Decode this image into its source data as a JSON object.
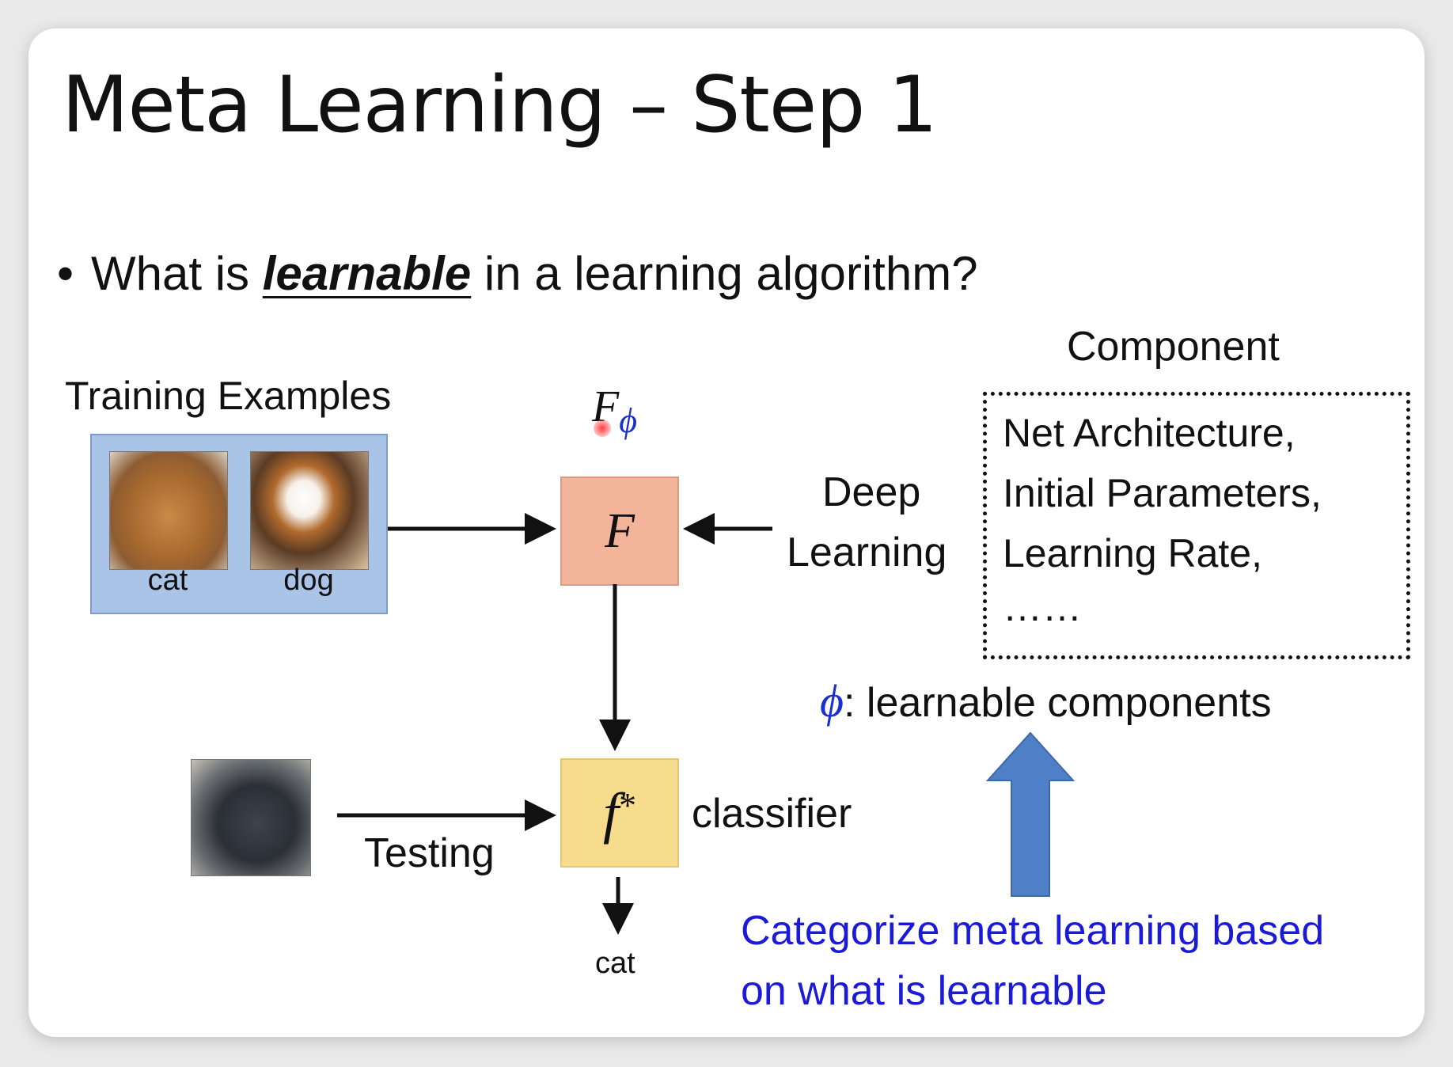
{
  "slide": {
    "title": "Meta Learning – Step 1",
    "bullet": {
      "prefix": "What is ",
      "emphasis": "learnable",
      "suffix": " in a learning algorithm?"
    },
    "training_examples": {
      "label": "Training Examples",
      "items": [
        "cat",
        "dog"
      ]
    },
    "learner": {
      "symbol": "F",
      "param_symbol": "F",
      "param_sub": "ϕ"
    },
    "classifier": {
      "symbol": "f",
      "star": "*",
      "label": "classifier"
    },
    "testing": {
      "label": "Testing",
      "output": "cat"
    },
    "deep_learning": [
      "Deep",
      "Learning"
    ],
    "component": {
      "heading": "Component",
      "items": [
        "Net Architecture,",
        "Initial Parameters,",
        "Learning Rate,",
        "……"
      ]
    },
    "phi_note": {
      "symbol": "ϕ",
      "text": ": learnable components"
    },
    "categorize_note": [
      "Categorize meta learning based",
      "on what is learnable"
    ]
  },
  "colors": {
    "learner_box": "#f4b49a",
    "classifier_box": "#f8dc8e",
    "training_panel": "#a9c4e6",
    "accent_blue_text": "#1a1ad8",
    "phi_blue": "#1a2fd0",
    "big_arrow": "#4f7fc7"
  },
  "icons": {
    "cursor": "red-dot-pointer"
  }
}
